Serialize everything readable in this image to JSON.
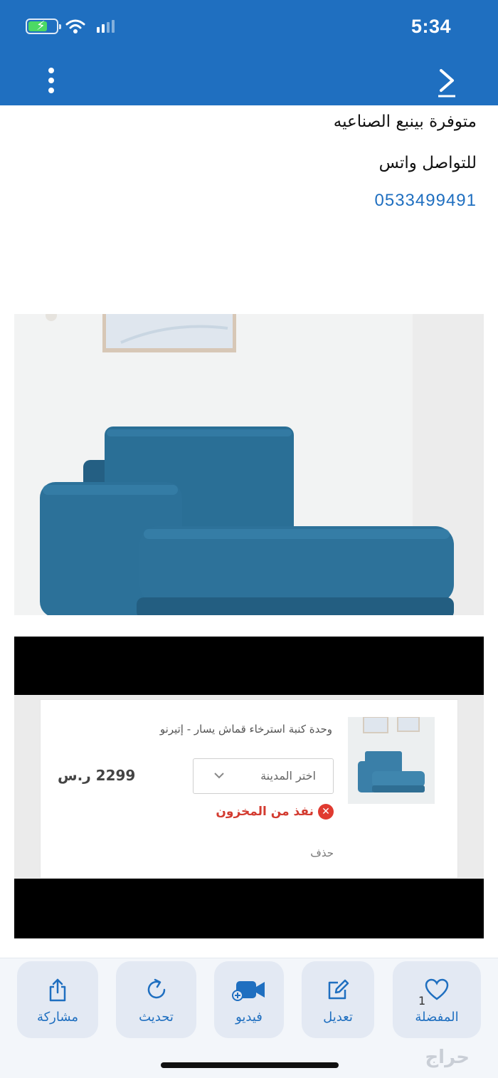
{
  "status_bar": {
    "time": "5:34"
  },
  "description": {
    "line1": "متوفرة بينبع الصناعيه",
    "line2": "للتواصل واتس",
    "phone": "0533499491"
  },
  "product_card": {
    "name": "وحدة كنبة استرخاء قماش يسار - إتيرنو",
    "city_placeholder": "اختر المدينة",
    "price": "2299 ر.س",
    "stock_status": "نفذ من المخزون",
    "delete_label": "حذف"
  },
  "bottom_bar": {
    "favorites_label": "المفضلة",
    "favorites_count": "1",
    "edit_label": "تعديل",
    "video_label": "فيديو",
    "refresh_label": "تحديث",
    "share_label": "مشاركة"
  },
  "logo_text": "حراج",
  "colors": {
    "brand_blue": "#1f6fc0",
    "sofa_blue": "#2a6f96",
    "out_of_stock_red": "#e03a30"
  }
}
